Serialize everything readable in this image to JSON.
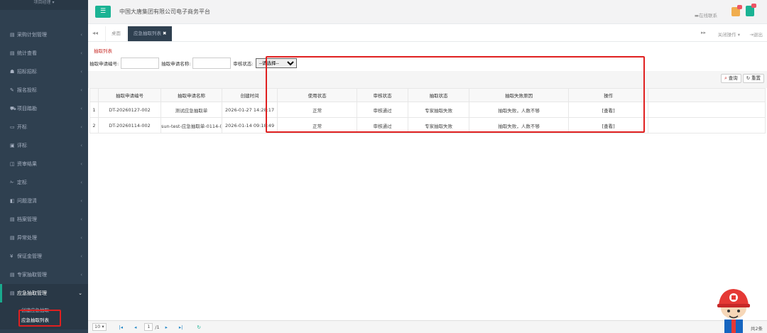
{
  "sidebar": {
    "brand": "项目经理 ▾",
    "items": [
      {
        "icon": "file-icon",
        "glyph": "▤",
        "label": "采购计划管理"
      },
      {
        "icon": "stats-icon",
        "glyph": "▤",
        "label": "统计查看"
      },
      {
        "icon": "users-icon",
        "glyph": "☗",
        "label": "招标招标"
      },
      {
        "icon": "edit-icon",
        "glyph": "✎",
        "label": "报名投标"
      },
      {
        "icon": "car-icon",
        "glyph": "⛟",
        "label": "项目踏勘"
      },
      {
        "icon": "monitor-icon",
        "glyph": "▭",
        "label": "开标"
      },
      {
        "icon": "image-icon",
        "glyph": "▣",
        "label": "评标"
      },
      {
        "icon": "bookmark-icon",
        "glyph": "◫",
        "label": "资审结果"
      },
      {
        "icon": "wrench-icon",
        "glyph": "✁",
        "label": "定标"
      },
      {
        "icon": "question-icon",
        "glyph": "◧",
        "label": "问题澄清"
      },
      {
        "icon": "archive-icon",
        "glyph": "▤",
        "label": "档案管理"
      },
      {
        "icon": "warning-icon",
        "glyph": "▤",
        "label": "异常处理"
      },
      {
        "icon": "yen-icon",
        "glyph": "¥",
        "label": "保证金管理"
      },
      {
        "icon": "expert-icon",
        "glyph": "▤",
        "label": "专家抽取管理"
      }
    ],
    "active": {
      "icon": "emergency-icon",
      "glyph": "▤",
      "label": "应急抽取管理"
    },
    "sub_items": [
      "创建应急抽取",
      "应急抽取列表"
    ]
  },
  "header": {
    "menu_glyph": "☰",
    "title": "中国大唐集团有限公司电子商务平台",
    "online": "▬在线联系"
  },
  "tabs": {
    "back_glyph": "◂◂",
    "home": "桌面",
    "active": "应急抽取列表",
    "close_glyph": "✖",
    "forward_glyph": "▸▸",
    "close_ops": "关闭操作 ▾",
    "logout": "⇥退出"
  },
  "content": {
    "panel_title": "抽取列表",
    "filters": {
      "apply_no_label": "抽取申请编号:",
      "apply_name_label": "抽取申请名称:",
      "status_label": "审核状态:",
      "status_selected": "--请选择--"
    },
    "buttons": {
      "search": "查询",
      "search_glyph": "⌕",
      "reset": "重置",
      "reset_glyph": "↻"
    },
    "table": {
      "headers": [
        "",
        "抽取申请编号",
        "抽取申请名称",
        "创建时间",
        "使用状态",
        "审核状态",
        "抽取状态",
        "抽取失败原因",
        "操作"
      ],
      "rows": [
        [
          "1",
          "DT-20260127-002",
          "测试应急抽取单",
          "2026-01-27 14:28:17",
          "正常",
          "审核通过",
          "专家抽取失败",
          "抽取失败，人数不够",
          "[查看]"
        ],
        [
          "2",
          "DT-20260114-002",
          "sun-test-应急抽取单-0114-(",
          "2026-01-14 09:18:49",
          "正常",
          "审核通过",
          "专家抽取失败",
          "抽取失败，人数不够",
          "[查看]"
        ]
      ]
    }
  },
  "pager": {
    "page_size": "10 ▾",
    "first": "|◂",
    "prev": "◂",
    "page": "1",
    "of": "/1",
    "next": "▸",
    "last": "▸|",
    "refresh": "↻",
    "total": "共2条"
  },
  "colors": {
    "sidebar_bg": "#2f4050",
    "accent": "#1ab394",
    "highlight": "#e02020"
  }
}
